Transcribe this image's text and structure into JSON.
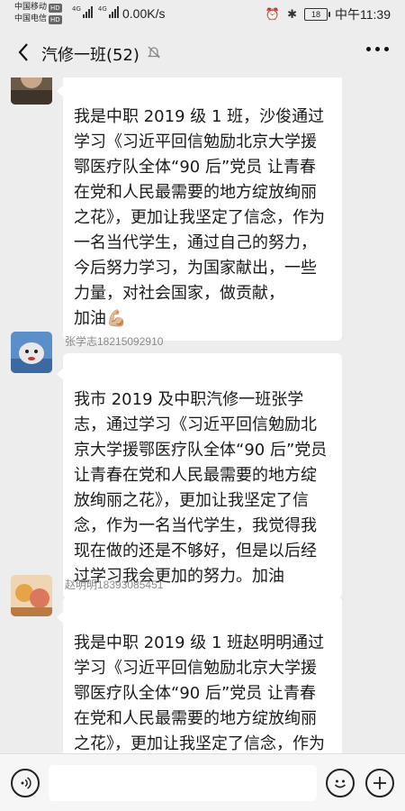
{
  "status_bar": {
    "carrier_1": "中国移动",
    "carrier_2": "中国电信",
    "hd_badge": "HD",
    "signal_label_1": "4G",
    "signal_label_2": "4G",
    "net_speed": "0.00K/s",
    "battery": "18",
    "time": "中午11:39"
  },
  "header": {
    "title": "汽修一班(52)"
  },
  "messages": [
    {
      "sender": "",
      "text": "我是中职 2019 级 1 班，沙俊通过学习《习近平回信勉励北京大学援鄂医疗队全体“90 后”党员 让青春在党和人民最需要的地方绽放绚丽之花》，更加让我坚定了信念，作为一名当代学生，通过自己的努力，今后努力学习，为国家献出，一些力量，对社会国家，做贡献，\n加油",
      "emoji": "💪🏼"
    },
    {
      "sender": "张学志18215092910",
      "text": "我市 2019 及中职汽修一班张学志，通过学习《习近平回信勉励北京大学援鄂医疗队全体“90 后”党员 让青春在党和人民最需要的地方绽放绚丽之花》，更加让我坚定了信念，作为一名当代学生，我觉得我现在做的还是不够好，但是以后经过学习我会更加的努力。加油",
      "emoji": ""
    },
    {
      "sender": "赵明明18393085451",
      "text": "我是中职 2019 级 1 班赵明明通过学习《习近平回信勉励北京大学援鄂医疗队全体“90 后”党员 让青春在党和人民最需要的地方绽放绚丽之花》，更加让我坚定了信念，作为一名当代职业技术中专学生，我们",
      "emoji": ""
    }
  ],
  "input_bar": {
    "placeholder": ""
  },
  "colors": {
    "background": "#ededed",
    "bubble": "#ffffff"
  }
}
